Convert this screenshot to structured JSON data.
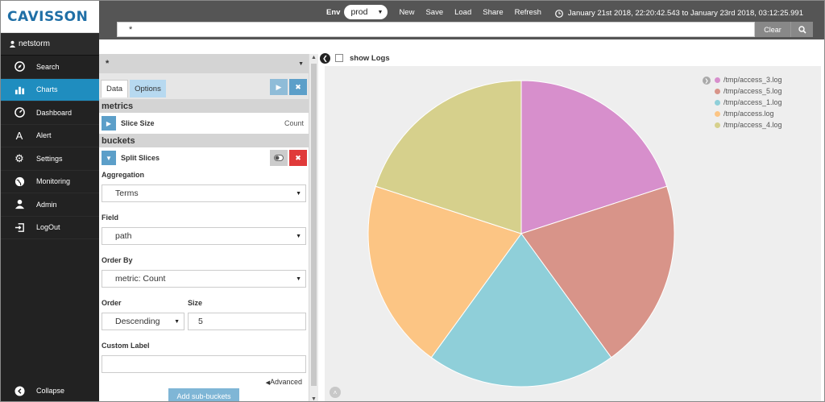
{
  "brand": {
    "logo_text": "CAVISSON"
  },
  "user": {
    "name": "netstorm"
  },
  "sidebar": {
    "items": [
      {
        "label": "Search",
        "icon": "compass-icon",
        "active": false
      },
      {
        "label": "Charts",
        "icon": "bar-chart-icon",
        "active": true
      },
      {
        "label": "Dashboard",
        "icon": "dashboard-icon",
        "active": false
      },
      {
        "label": "Alert",
        "icon": "alert-icon",
        "active": false
      },
      {
        "label": "Settings",
        "icon": "gear-icon",
        "active": false
      },
      {
        "label": "Monitoring",
        "icon": "globe-icon",
        "active": false
      },
      {
        "label": "Admin",
        "icon": "user-icon",
        "active": false
      },
      {
        "label": "LogOut",
        "icon": "logout-icon",
        "active": false
      }
    ],
    "collapse_label": "Collapse"
  },
  "topbar": {
    "env_label": "Env",
    "env_value": "prod",
    "menu": [
      "New",
      "Save",
      "Load",
      "Share",
      "Refresh"
    ],
    "time_range": "January 21st 2018, 22:20:42.543 to January 23rd 2018, 03:12:25.991",
    "query": "*",
    "clear_label": "Clear"
  },
  "editor": {
    "index_pattern": "*",
    "tabs": {
      "data": "Data",
      "options": "Options"
    },
    "metrics_title": "metrics",
    "metric": {
      "label": "Slice Size",
      "value": "Count"
    },
    "buckets_title": "buckets",
    "bucket": {
      "label": "Split Slices"
    },
    "aggregation": {
      "label": "Aggregation",
      "value": "Terms"
    },
    "field": {
      "label": "Field",
      "value": "path"
    },
    "order_by": {
      "label": "Order By",
      "value": "metric: Count"
    },
    "order": {
      "label": "Order",
      "value": "Descending"
    },
    "size": {
      "label": "Size",
      "value": "5"
    },
    "custom_label": {
      "label": "Custom Label",
      "value": ""
    },
    "advanced_label": "Advanced",
    "add_sub_buckets": "Add sub-buckets"
  },
  "vis": {
    "show_logs_label": "show Logs",
    "colors": {
      "accent": "#1f8dbf",
      "sidebar": "#222222",
      "topbar": "#555555"
    }
  },
  "chart_data": {
    "type": "pie",
    "labels": [
      "/tmp/access_3.log",
      "/tmp/access_5.log",
      "/tmp/access_1.log",
      "/tmp/access.log",
      "/tmp/access_4.log"
    ],
    "values": [
      1,
      1,
      1,
      1,
      1
    ],
    "colors": [
      "#d78fcc",
      "#d89489",
      "#8fcfd9",
      "#fcc584",
      "#d6d08c"
    ],
    "legend_position": "top-right"
  }
}
